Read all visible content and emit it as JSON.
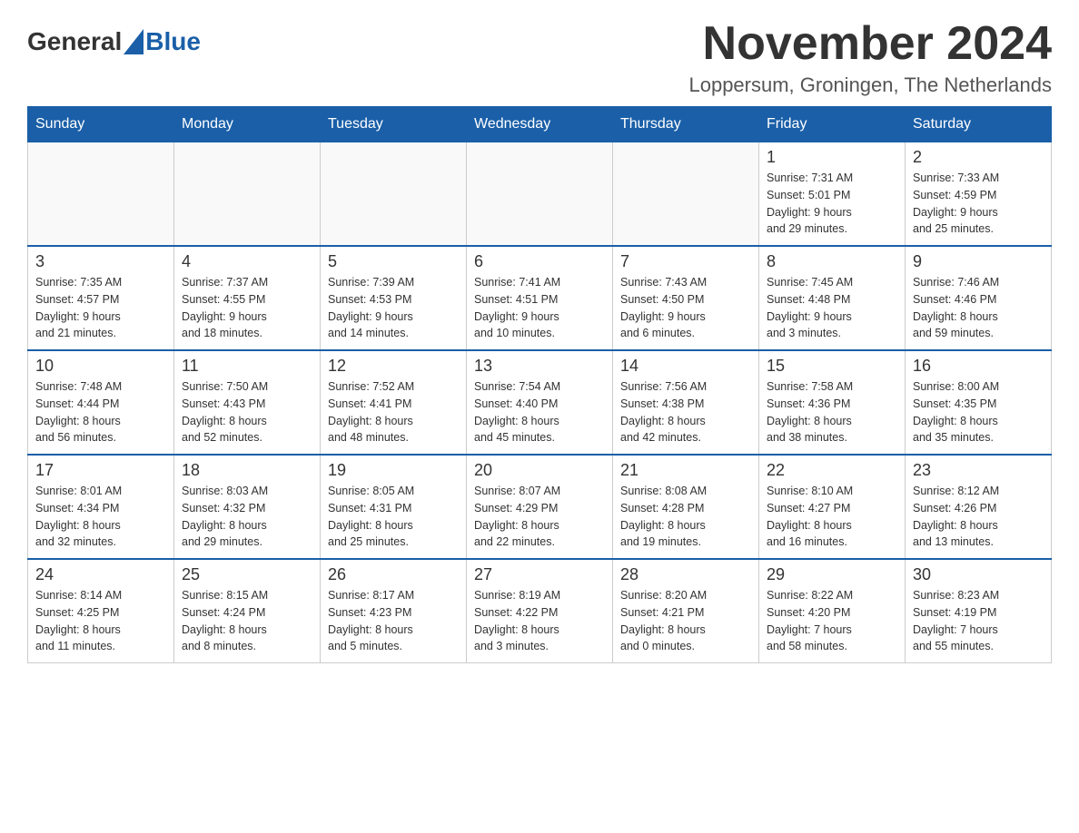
{
  "header": {
    "month_title": "November 2024",
    "location": "Loppersum, Groningen, The Netherlands",
    "logo_general": "General",
    "logo_blue": "Blue"
  },
  "weekdays": [
    "Sunday",
    "Monday",
    "Tuesday",
    "Wednesday",
    "Thursday",
    "Friday",
    "Saturday"
  ],
  "weeks": [
    [
      {
        "day": "",
        "info": ""
      },
      {
        "day": "",
        "info": ""
      },
      {
        "day": "",
        "info": ""
      },
      {
        "day": "",
        "info": ""
      },
      {
        "day": "",
        "info": ""
      },
      {
        "day": "1",
        "info": "Sunrise: 7:31 AM\nSunset: 5:01 PM\nDaylight: 9 hours\nand 29 minutes."
      },
      {
        "day": "2",
        "info": "Sunrise: 7:33 AM\nSunset: 4:59 PM\nDaylight: 9 hours\nand 25 minutes."
      }
    ],
    [
      {
        "day": "3",
        "info": "Sunrise: 7:35 AM\nSunset: 4:57 PM\nDaylight: 9 hours\nand 21 minutes."
      },
      {
        "day": "4",
        "info": "Sunrise: 7:37 AM\nSunset: 4:55 PM\nDaylight: 9 hours\nand 18 minutes."
      },
      {
        "day": "5",
        "info": "Sunrise: 7:39 AM\nSunset: 4:53 PM\nDaylight: 9 hours\nand 14 minutes."
      },
      {
        "day": "6",
        "info": "Sunrise: 7:41 AM\nSunset: 4:51 PM\nDaylight: 9 hours\nand 10 minutes."
      },
      {
        "day": "7",
        "info": "Sunrise: 7:43 AM\nSunset: 4:50 PM\nDaylight: 9 hours\nand 6 minutes."
      },
      {
        "day": "8",
        "info": "Sunrise: 7:45 AM\nSunset: 4:48 PM\nDaylight: 9 hours\nand 3 minutes."
      },
      {
        "day": "9",
        "info": "Sunrise: 7:46 AM\nSunset: 4:46 PM\nDaylight: 8 hours\nand 59 minutes."
      }
    ],
    [
      {
        "day": "10",
        "info": "Sunrise: 7:48 AM\nSunset: 4:44 PM\nDaylight: 8 hours\nand 56 minutes."
      },
      {
        "day": "11",
        "info": "Sunrise: 7:50 AM\nSunset: 4:43 PM\nDaylight: 8 hours\nand 52 minutes."
      },
      {
        "day": "12",
        "info": "Sunrise: 7:52 AM\nSunset: 4:41 PM\nDaylight: 8 hours\nand 48 minutes."
      },
      {
        "day": "13",
        "info": "Sunrise: 7:54 AM\nSunset: 4:40 PM\nDaylight: 8 hours\nand 45 minutes."
      },
      {
        "day": "14",
        "info": "Sunrise: 7:56 AM\nSunset: 4:38 PM\nDaylight: 8 hours\nand 42 minutes."
      },
      {
        "day": "15",
        "info": "Sunrise: 7:58 AM\nSunset: 4:36 PM\nDaylight: 8 hours\nand 38 minutes."
      },
      {
        "day": "16",
        "info": "Sunrise: 8:00 AM\nSunset: 4:35 PM\nDaylight: 8 hours\nand 35 minutes."
      }
    ],
    [
      {
        "day": "17",
        "info": "Sunrise: 8:01 AM\nSunset: 4:34 PM\nDaylight: 8 hours\nand 32 minutes."
      },
      {
        "day": "18",
        "info": "Sunrise: 8:03 AM\nSunset: 4:32 PM\nDaylight: 8 hours\nand 29 minutes."
      },
      {
        "day": "19",
        "info": "Sunrise: 8:05 AM\nSunset: 4:31 PM\nDaylight: 8 hours\nand 25 minutes."
      },
      {
        "day": "20",
        "info": "Sunrise: 8:07 AM\nSunset: 4:29 PM\nDaylight: 8 hours\nand 22 minutes."
      },
      {
        "day": "21",
        "info": "Sunrise: 8:08 AM\nSunset: 4:28 PM\nDaylight: 8 hours\nand 19 minutes."
      },
      {
        "day": "22",
        "info": "Sunrise: 8:10 AM\nSunset: 4:27 PM\nDaylight: 8 hours\nand 16 minutes."
      },
      {
        "day": "23",
        "info": "Sunrise: 8:12 AM\nSunset: 4:26 PM\nDaylight: 8 hours\nand 13 minutes."
      }
    ],
    [
      {
        "day": "24",
        "info": "Sunrise: 8:14 AM\nSunset: 4:25 PM\nDaylight: 8 hours\nand 11 minutes."
      },
      {
        "day": "25",
        "info": "Sunrise: 8:15 AM\nSunset: 4:24 PM\nDaylight: 8 hours\nand 8 minutes."
      },
      {
        "day": "26",
        "info": "Sunrise: 8:17 AM\nSunset: 4:23 PM\nDaylight: 8 hours\nand 5 minutes."
      },
      {
        "day": "27",
        "info": "Sunrise: 8:19 AM\nSunset: 4:22 PM\nDaylight: 8 hours\nand 3 minutes."
      },
      {
        "day": "28",
        "info": "Sunrise: 8:20 AM\nSunset: 4:21 PM\nDaylight: 8 hours\nand 0 minutes."
      },
      {
        "day": "29",
        "info": "Sunrise: 8:22 AM\nSunset: 4:20 PM\nDaylight: 7 hours\nand 58 minutes."
      },
      {
        "day": "30",
        "info": "Sunrise: 8:23 AM\nSunset: 4:19 PM\nDaylight: 7 hours\nand 55 minutes."
      }
    ]
  ]
}
